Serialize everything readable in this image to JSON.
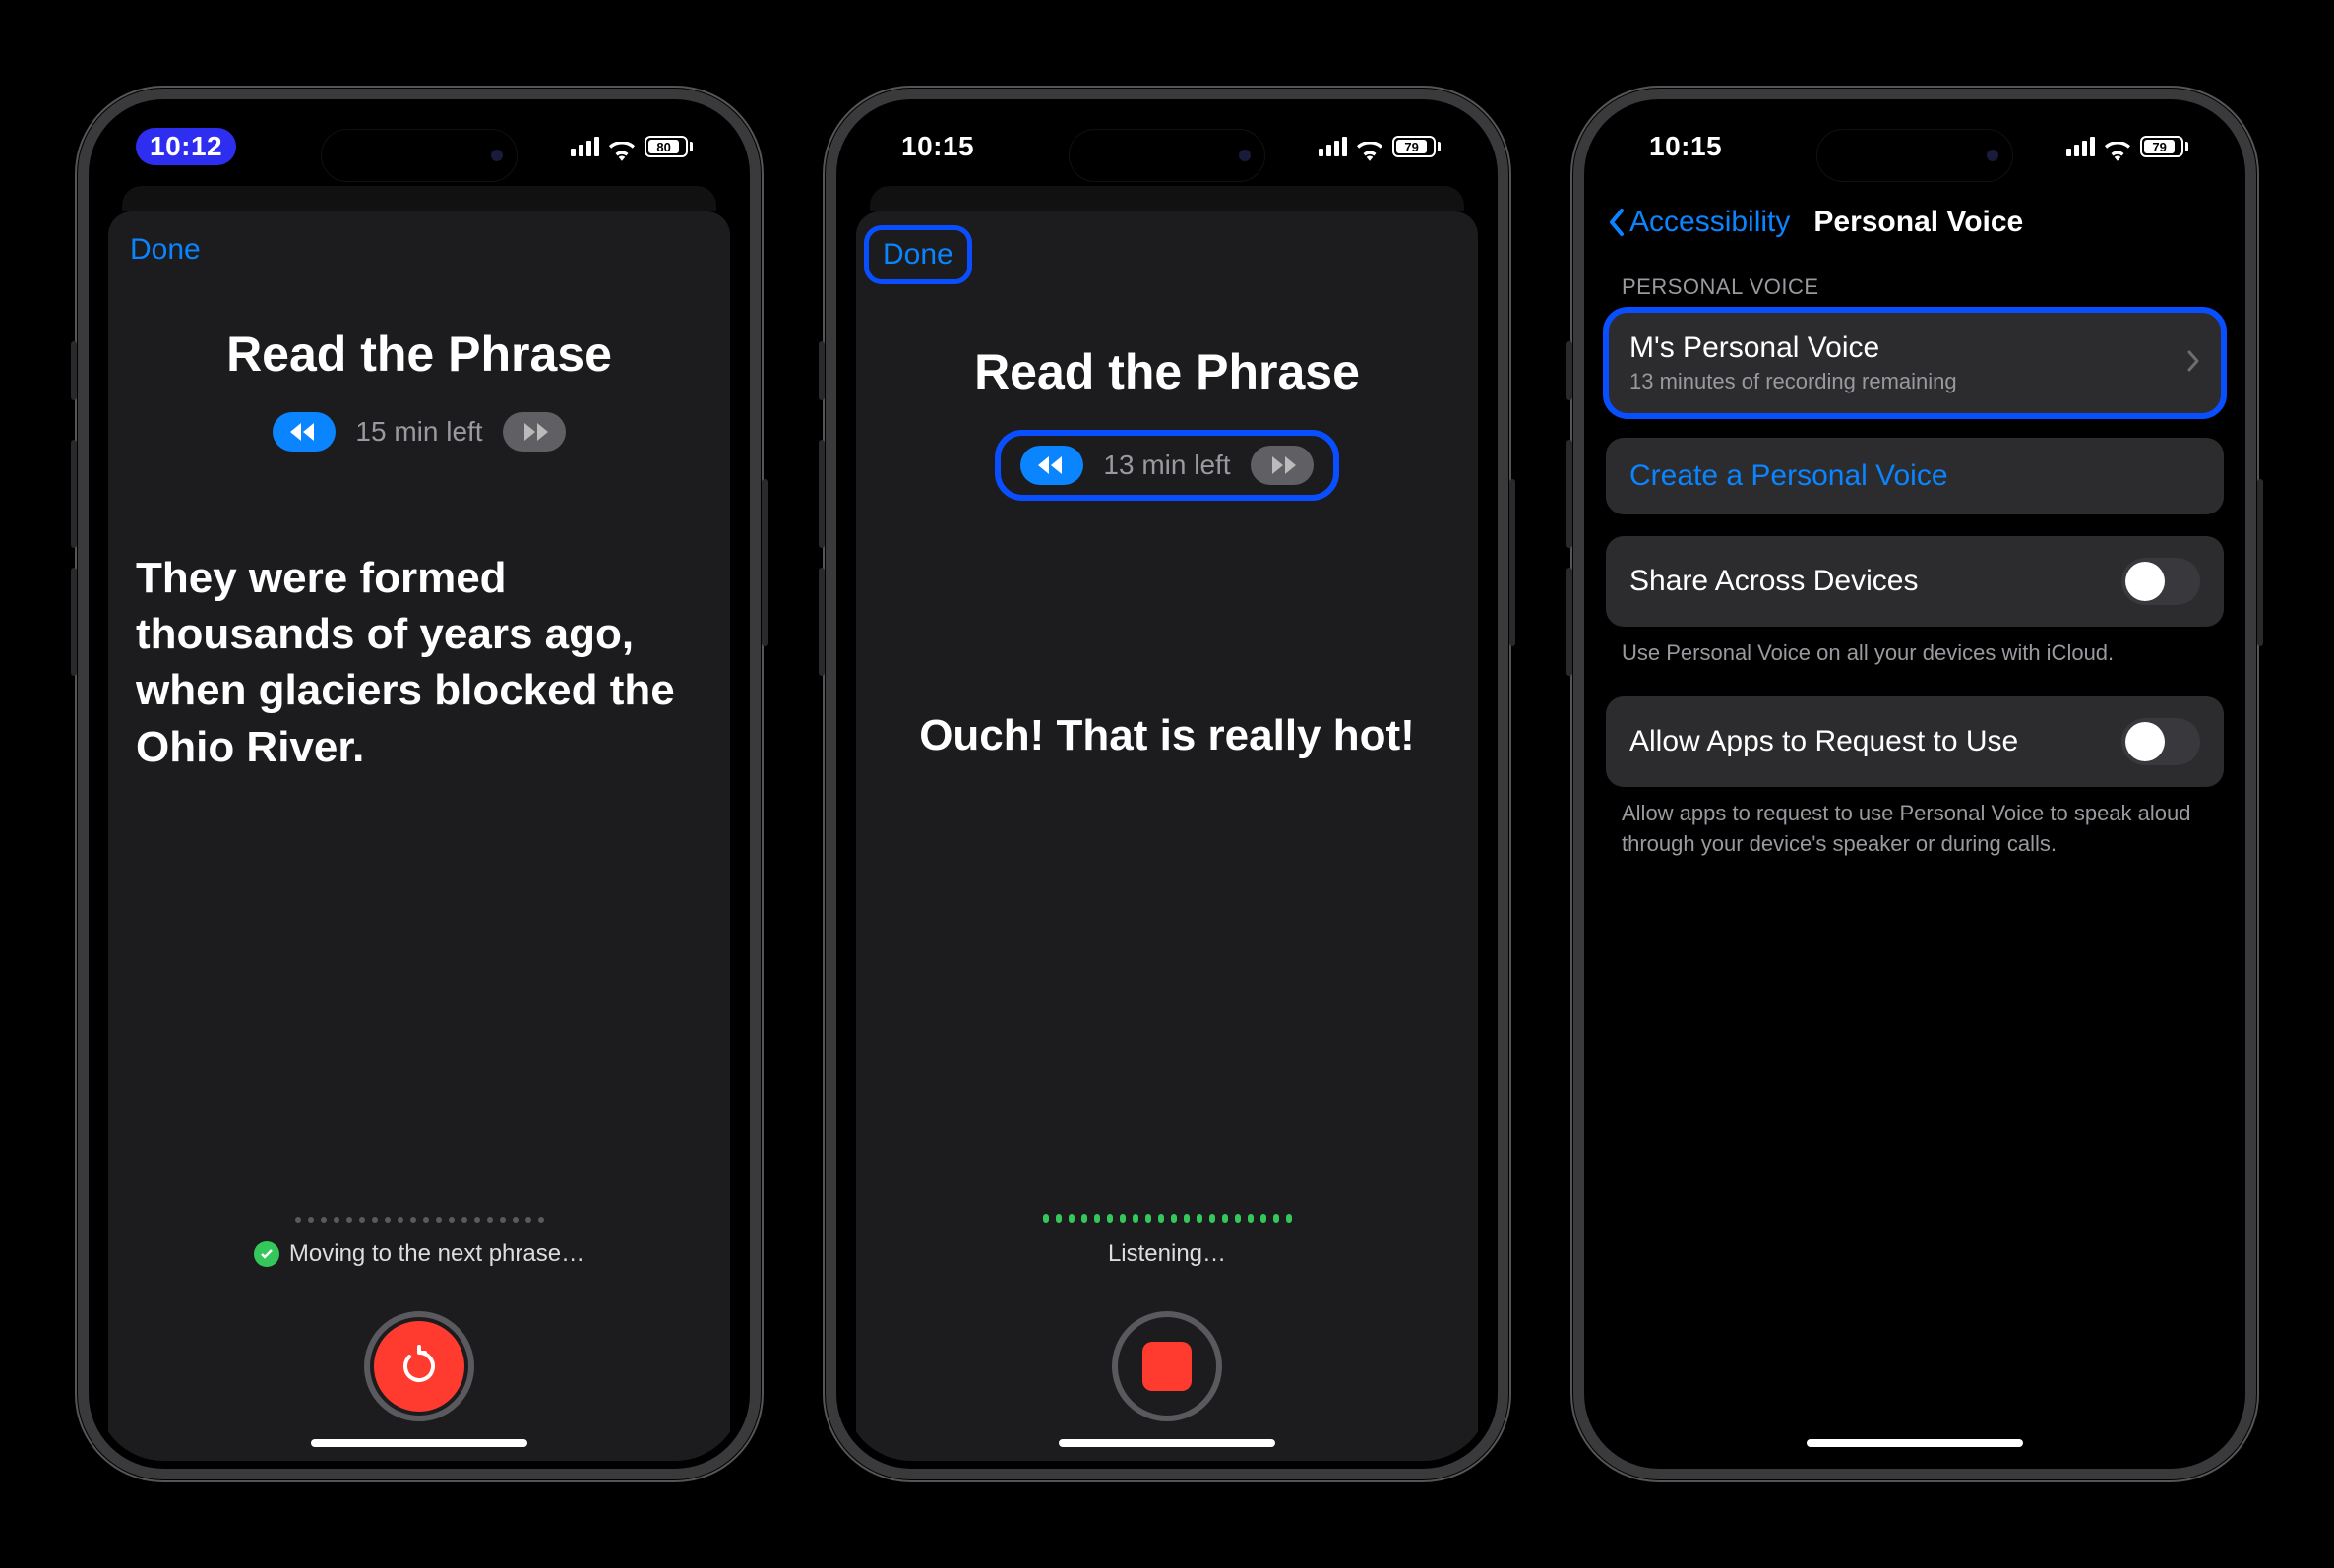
{
  "phone1": {
    "time": "10:12",
    "battery": "80",
    "done": "Done",
    "title": "Read the Phrase",
    "time_left": "15 min left",
    "phrase": "They were formed thousands of years ago, when glaciers blocked the Ohio River.",
    "status": "Moving to the next phrase…"
  },
  "phone2": {
    "time": "10:15",
    "battery": "79",
    "done": "Done",
    "title": "Read the Phrase",
    "time_left": "13 min left",
    "phrase": "Ouch! That is really hot!",
    "status": "Listening…"
  },
  "phone3": {
    "time": "10:15",
    "battery": "79",
    "back": "Accessibility",
    "nav_title": "Personal Voice",
    "section_header": "Personal Voice",
    "voice_name": "M's Personal Voice",
    "voice_sub": "13 minutes of recording remaining",
    "create": "Create a Personal Voice",
    "share_label": "Share Across Devices",
    "share_help": "Use Personal Voice on all your devices with iCloud.",
    "allow_label": "Allow Apps to Request to Use",
    "allow_help": "Allow apps to request to use Personal Voice to speak aloud through your device's speaker or during calls."
  }
}
